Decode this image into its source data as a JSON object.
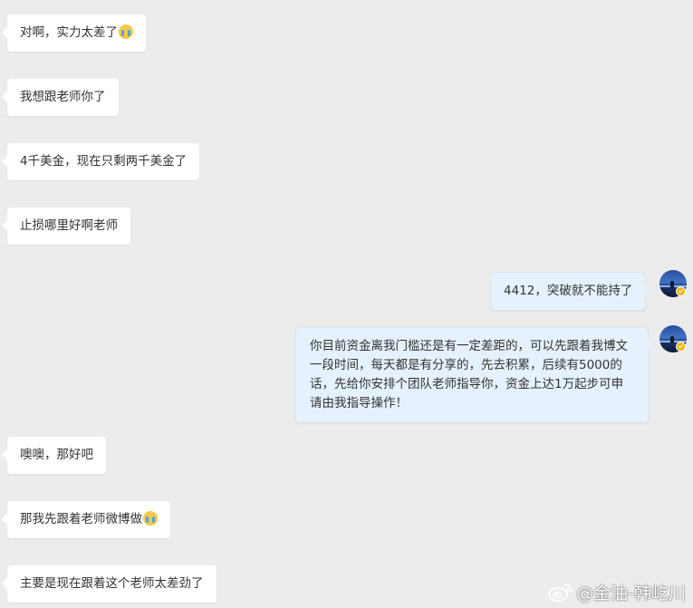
{
  "messages": [
    {
      "side": "left",
      "text": "对啊，实力太差了",
      "emoji": "crying-emoji"
    },
    {
      "side": "left",
      "text": "我想跟老师你了"
    },
    {
      "side": "left",
      "text": "4千美金，现在只剩两千美金了"
    },
    {
      "side": "left",
      "text": "止损哪里好啊老师"
    },
    {
      "side": "right",
      "text": "4412，突破就不能持了"
    },
    {
      "side": "right",
      "text": "你目前资金离我门槛还是有一定差距的，可以先跟着我博文一段时间，每天都是有分享的，先去积累，后续有5000的话，先给你安排个团队老师指导你，资金上达1万起步可申请由我指导操作！"
    },
    {
      "side": "left",
      "text": "噢噢，那好吧"
    },
    {
      "side": "left",
      "text": "那我先跟着老师微博做",
      "emoji": "crying-emoji"
    },
    {
      "side": "left",
      "text": "主要是现在跟着这个老师太差劲了"
    }
  ],
  "watermark": {
    "text": "@金油-韩屹川",
    "icon": "weibo-logo"
  },
  "colors": {
    "background": "#ececec",
    "incoming_bubble": "#ffffff",
    "outgoing_bubble": "#e5f1fc",
    "verified_badge": "#f4b200"
  }
}
